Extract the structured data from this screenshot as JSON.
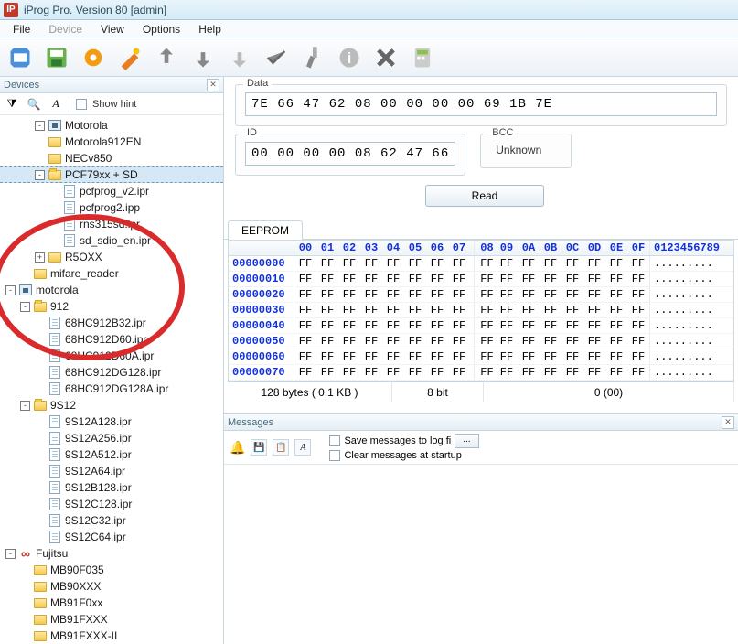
{
  "window": {
    "title": "iProg Pro. Version 80 [admin]",
    "icon_text": "IP"
  },
  "menu": {
    "file": "File",
    "device": "Device",
    "view": "View",
    "options": "Options",
    "help": "Help"
  },
  "devices_panel": {
    "title": "Devices",
    "show_hint": "Show hint"
  },
  "tree": [
    {
      "level": 2,
      "twisty": "-",
      "icon": "chip",
      "label": "Motorola"
    },
    {
      "level": 2,
      "twisty": "",
      "icon": "folder",
      "label": "Motorola912EN"
    },
    {
      "level": 2,
      "twisty": "",
      "icon": "folder",
      "label": "NECv850"
    },
    {
      "level": 2,
      "twisty": "-",
      "icon": "folder-open",
      "label": "PCF79xx + SD",
      "selected": true
    },
    {
      "level": 3,
      "twisty": "",
      "icon": "file",
      "label": "pcfprog_v2.ipr"
    },
    {
      "level": 3,
      "twisty": "",
      "icon": "file",
      "label": "pcfprog2.ipp"
    },
    {
      "level": 3,
      "twisty": "",
      "icon": "file",
      "label": "rns315sd.ipr"
    },
    {
      "level": 3,
      "twisty": "",
      "icon": "file",
      "label": "sd_sdio_en.ipr"
    },
    {
      "level": 2,
      "twisty": "+",
      "icon": "folder",
      "label": "R5OXX"
    },
    {
      "level": 1,
      "twisty": "",
      "icon": "folder",
      "label": "mifare_reader"
    },
    {
      "level": 0,
      "twisty": "-",
      "icon": "chip",
      "label": "motorola"
    },
    {
      "level": 1,
      "twisty": "-",
      "icon": "folder-open",
      "label": "912"
    },
    {
      "level": 2,
      "twisty": "",
      "icon": "file",
      "label": "68HC912B32.ipr"
    },
    {
      "level": 2,
      "twisty": "",
      "icon": "file",
      "label": "68HC912D60.ipr"
    },
    {
      "level": 2,
      "twisty": "",
      "icon": "file",
      "label": "68HC912D60A.ipr"
    },
    {
      "level": 2,
      "twisty": "",
      "icon": "file",
      "label": "68HC912DG128.ipr"
    },
    {
      "level": 2,
      "twisty": "",
      "icon": "file",
      "label": "68HC912DG128A.ipr"
    },
    {
      "level": 1,
      "twisty": "-",
      "icon": "folder-open",
      "label": "9S12"
    },
    {
      "level": 2,
      "twisty": "",
      "icon": "file",
      "label": "9S12A128.ipr"
    },
    {
      "level": 2,
      "twisty": "",
      "icon": "file",
      "label": "9S12A256.ipr"
    },
    {
      "level": 2,
      "twisty": "",
      "icon": "file",
      "label": "9S12A512.ipr"
    },
    {
      "level": 2,
      "twisty": "",
      "icon": "file",
      "label": "9S12A64.ipr"
    },
    {
      "level": 2,
      "twisty": "",
      "icon": "file",
      "label": "9S12B128.ipr"
    },
    {
      "level": 2,
      "twisty": "",
      "icon": "file",
      "label": "9S12C128.ipr"
    },
    {
      "level": 2,
      "twisty": "",
      "icon": "file",
      "label": "9S12C32.ipr"
    },
    {
      "level": 2,
      "twisty": "",
      "icon": "file",
      "label": "9S12C64.ipr"
    },
    {
      "level": 0,
      "twisty": "-",
      "icon": "infinity",
      "label": "Fujitsu"
    },
    {
      "level": 1,
      "twisty": "",
      "icon": "folder",
      "label": "MB90F035"
    },
    {
      "level": 1,
      "twisty": "",
      "icon": "folder",
      "label": "MB90XXX"
    },
    {
      "level": 1,
      "twisty": "",
      "icon": "folder",
      "label": "MB91F0xx"
    },
    {
      "level": 1,
      "twisty": "",
      "icon": "folder",
      "label": "MB91FXXX"
    },
    {
      "level": 1,
      "twisty": "",
      "icon": "folder",
      "label": "MB91FXXX-II"
    }
  ],
  "form": {
    "data_label": "Data",
    "data_value": "7E 66 47 62 08 00 00 00 00 69 1B 7E",
    "id_label": "ID",
    "id_value": "00 00 00 00 08 62 47 66",
    "bcc_label": "BCC",
    "bcc_value": "Unknown",
    "read_btn": "Read"
  },
  "eeprom": {
    "tab": "EEPROM",
    "cols": [
      "00",
      "01",
      "02",
      "03",
      "04",
      "05",
      "06",
      "07",
      "08",
      "09",
      "0A",
      "0B",
      "0C",
      "0D",
      "0E",
      "0F"
    ],
    "ascii_hdr": "0123456789",
    "rows": [
      {
        "addr": "00000000",
        "vals": [
          "FF",
          "FF",
          "FF",
          "FF",
          "FF",
          "FF",
          "FF",
          "FF",
          "FF",
          "FF",
          "FF",
          "FF",
          "FF",
          "FF",
          "FF",
          "FF"
        ],
        "asc": "........."
      },
      {
        "addr": "00000010",
        "vals": [
          "FF",
          "FF",
          "FF",
          "FF",
          "FF",
          "FF",
          "FF",
          "FF",
          "FF",
          "FF",
          "FF",
          "FF",
          "FF",
          "FF",
          "FF",
          "FF"
        ],
        "asc": "........."
      },
      {
        "addr": "00000020",
        "vals": [
          "FF",
          "FF",
          "FF",
          "FF",
          "FF",
          "FF",
          "FF",
          "FF",
          "FF",
          "FF",
          "FF",
          "FF",
          "FF",
          "FF",
          "FF",
          "FF"
        ],
        "asc": "........."
      },
      {
        "addr": "00000030",
        "vals": [
          "FF",
          "FF",
          "FF",
          "FF",
          "FF",
          "FF",
          "FF",
          "FF",
          "FF",
          "FF",
          "FF",
          "FF",
          "FF",
          "FF",
          "FF",
          "FF"
        ],
        "asc": "........."
      },
      {
        "addr": "00000040",
        "vals": [
          "FF",
          "FF",
          "FF",
          "FF",
          "FF",
          "FF",
          "FF",
          "FF",
          "FF",
          "FF",
          "FF",
          "FF",
          "FF",
          "FF",
          "FF",
          "FF"
        ],
        "asc": "........."
      },
      {
        "addr": "00000050",
        "vals": [
          "FF",
          "FF",
          "FF",
          "FF",
          "FF",
          "FF",
          "FF",
          "FF",
          "FF",
          "FF",
          "FF",
          "FF",
          "FF",
          "FF",
          "FF",
          "FF"
        ],
        "asc": "........."
      },
      {
        "addr": "00000060",
        "vals": [
          "FF",
          "FF",
          "FF",
          "FF",
          "FF",
          "FF",
          "FF",
          "FF",
          "FF",
          "FF",
          "FF",
          "FF",
          "FF",
          "FF",
          "FF",
          "FF"
        ],
        "asc": "........."
      },
      {
        "addr": "00000070",
        "vals": [
          "FF",
          "FF",
          "FF",
          "FF",
          "FF",
          "FF",
          "FF",
          "FF",
          "FF",
          "FF",
          "FF",
          "FF",
          "FF",
          "FF",
          "FF",
          "FF"
        ],
        "asc": "........."
      }
    ],
    "status": {
      "size": "128 bytes ( 0.1 KB )",
      "bits": "8 bit",
      "pos": "0 (00)"
    }
  },
  "messages": {
    "title": "Messages",
    "save_log": "Save messages to log fi",
    "clear_startup": "Clear messages at startup",
    "btn": "..."
  }
}
